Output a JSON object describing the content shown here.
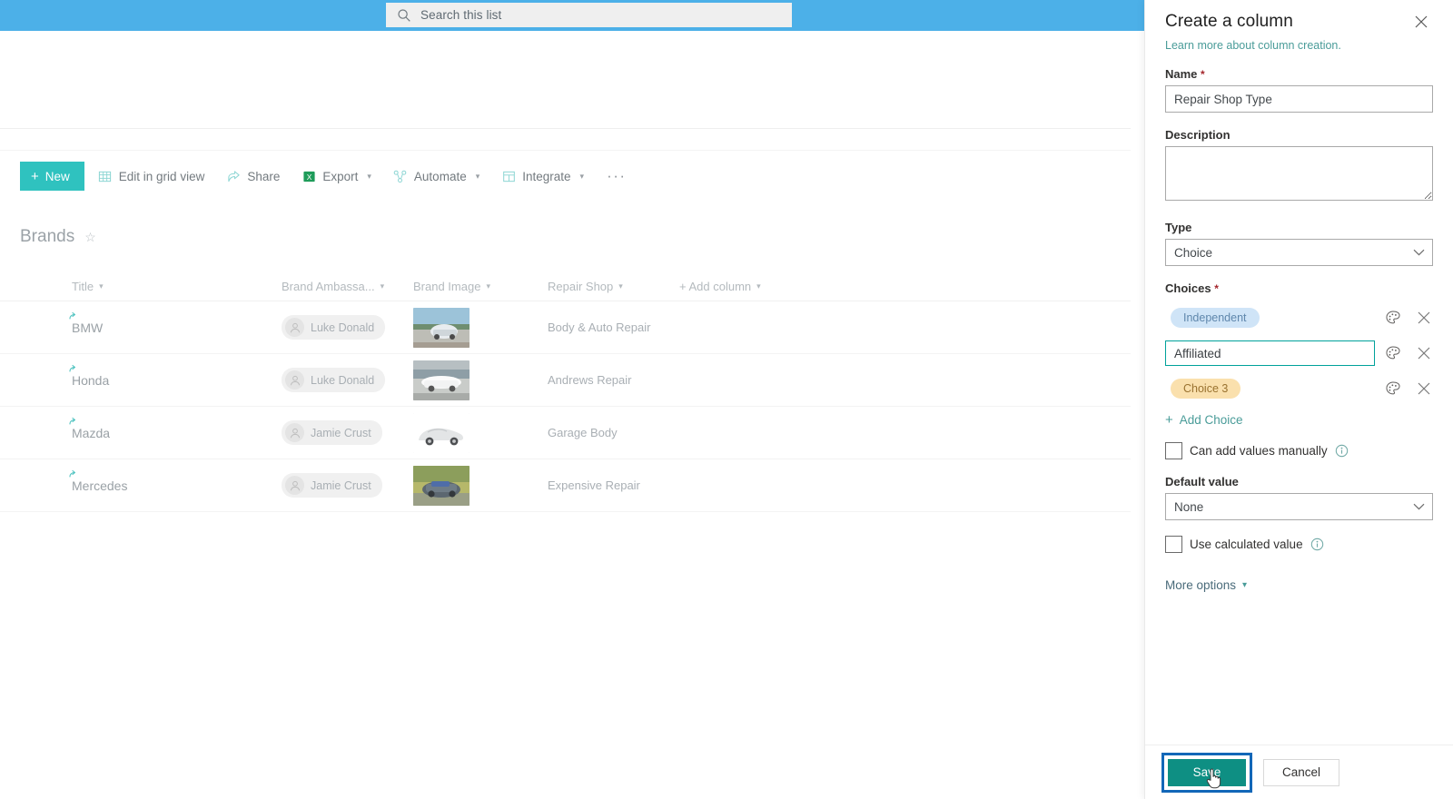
{
  "suitebar": {
    "search": {
      "placeholder": "Search this list",
      "value": "",
      "icon": "search-icon"
    }
  },
  "command_bar": {
    "new_label": "New",
    "items": [
      {
        "label": "Edit in grid view",
        "icon": "grid-icon",
        "caret": false
      },
      {
        "label": "Share",
        "icon": "share-icon",
        "caret": false
      },
      {
        "label": "Export",
        "icon": "excel-icon",
        "caret": true
      },
      {
        "label": "Automate",
        "icon": "automate-icon",
        "caret": true
      },
      {
        "label": "Integrate",
        "icon": "integrate-icon",
        "caret": true
      }
    ],
    "overflow_label": "···"
  },
  "list": {
    "title": "Brands",
    "favorite_icon": "star-icon",
    "columns": [
      {
        "label": "Title",
        "caret": true
      },
      {
        "label": "Brand Ambassa...",
        "caret": true
      },
      {
        "label": "Brand Image",
        "caret": true
      },
      {
        "label": "Repair Shop",
        "caret": true
      },
      {
        "label": "+ Add column",
        "caret": true
      }
    ],
    "rows": [
      {
        "title": "BMW",
        "ambassador": "Luke Donald",
        "image_alt": "car-thumbnail-bmw",
        "repair_shop": "Body & Auto Repair"
      },
      {
        "title": "Honda",
        "ambassador": "Luke Donald",
        "image_alt": "car-thumbnail-honda",
        "repair_shop": "Andrews Repair"
      },
      {
        "title": "Mazda",
        "ambassador": "Jamie Crust",
        "image_alt": "car-thumbnail-mazda",
        "repair_shop": "Garage Body"
      },
      {
        "title": "Mercedes",
        "ambassador": "Jamie Crust",
        "image_alt": "car-thumbnail-mercedes",
        "repair_shop": "Expensive Repair"
      }
    ]
  },
  "panel": {
    "title": "Create a column",
    "close_icon": "close-icon",
    "learn_more": "Learn more about column creation.",
    "name": {
      "label": "Name",
      "required": "*",
      "value": "Repair Shop Type",
      "placeholder": ""
    },
    "description": {
      "label": "Description",
      "value": "",
      "placeholder": ""
    },
    "type": {
      "label": "Type",
      "value": "Choice"
    },
    "choices": {
      "label": "Choices",
      "required": "*",
      "items": [
        {
          "text": "Independent",
          "state": "pill",
          "bg": "#cfe4f7",
          "fg": "#5f87ac",
          "palette_icon": "palette-icon",
          "remove_icon": "close-icon"
        },
        {
          "text": "Affiliated",
          "state": "editing",
          "bg": "#ffffff",
          "fg": "#3b3f43",
          "palette_icon": "palette-icon",
          "remove_icon": "close-icon"
        },
        {
          "text": "Choice 3",
          "state": "pill",
          "bg": "#fae0ad",
          "fg": "#9a7230",
          "palette_icon": "palette-icon",
          "remove_icon": "close-icon"
        }
      ],
      "add_label": "Add Choice"
    },
    "can_add_manually": {
      "label": "Can add values manually",
      "checked": false,
      "info_icon": "info-icon"
    },
    "default_value": {
      "label": "Default value",
      "value": "None"
    },
    "use_calculated": {
      "label": "Use calculated value",
      "checked": false,
      "info_icon": "info-icon"
    },
    "more_options": "More options",
    "footer": {
      "save_label": "Save",
      "cancel_label": "Cancel"
    }
  },
  "colors": {
    "suitebar_blue": "#4cb0e8",
    "accent_teal": "#2fc2bf",
    "save_teal": "#0e8f83",
    "focus_blue": "#1267b8",
    "link_teal": "#4a9c99"
  }
}
